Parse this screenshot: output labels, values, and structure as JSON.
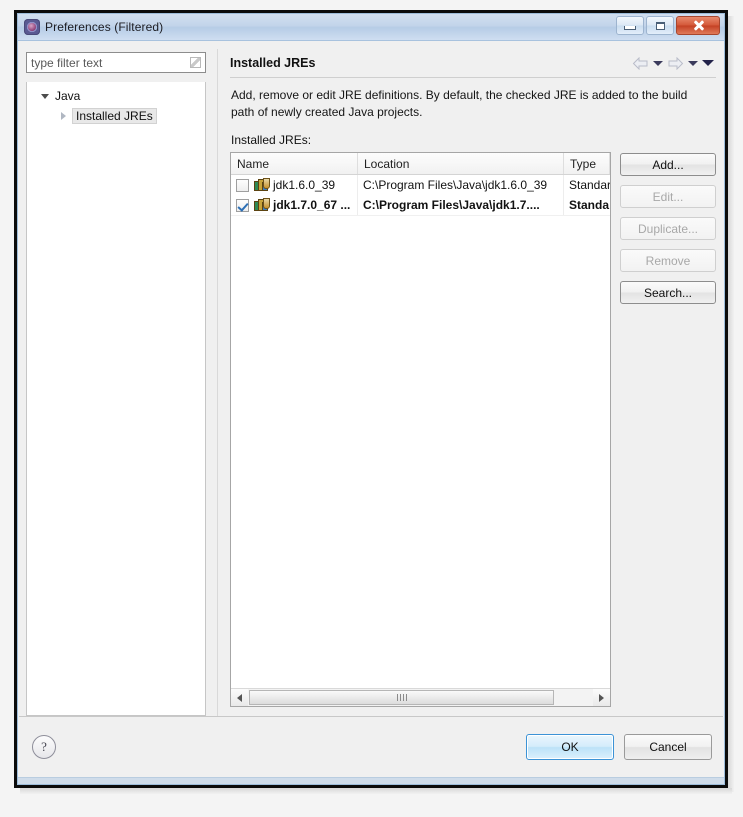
{
  "window": {
    "title": "Preferences (Filtered)",
    "icon": "preferences-gear-icon",
    "buttons": {
      "minimize": "minimize-icon",
      "maximize": "maximize-icon",
      "close": "close-icon"
    }
  },
  "sidebar": {
    "filter": {
      "placeholder": "type filter text",
      "value": ""
    },
    "tree": [
      {
        "label": "Java",
        "expanded": true,
        "level": 1,
        "selected": false
      },
      {
        "label": "Installed JREs",
        "expanded": false,
        "level": 2,
        "selected": true
      }
    ]
  },
  "pane": {
    "title": "Installed JREs",
    "description": "Add, remove or edit JRE definitions. By default, the checked JRE is added to the build path of newly created Java projects.",
    "nav": {
      "back": "back-arrow-icon",
      "back_menu": "back-dropdown-icon",
      "forward": "forward-arrow-icon",
      "forward_menu": "forward-dropdown-icon",
      "menu": "view-menu-icon"
    },
    "table_label": "Installed JREs:",
    "columns": [
      "Name",
      "Location",
      "Type"
    ],
    "rows": [
      {
        "checked": false,
        "bold": false,
        "name": "jdk1.6.0_39",
        "location": "C:\\Program Files\\Java\\jdk1.6.0_39",
        "type": "Standar"
      },
      {
        "checked": true,
        "bold": true,
        "name": "jdk1.7.0_67 ...",
        "location": "C:\\Program Files\\Java\\jdk1.7....",
        "type": "Standa"
      }
    ],
    "side_buttons": [
      {
        "label": "Add...",
        "enabled": true
      },
      {
        "label": "Edit...",
        "enabled": false
      },
      {
        "label": "Duplicate...",
        "enabled": false
      },
      {
        "label": "Remove",
        "enabled": false
      },
      {
        "label": "Search...",
        "enabled": true
      }
    ],
    "scrollbar": {
      "left_arrow": "scroll-left-icon",
      "right_arrow": "scroll-right-icon",
      "thumb": "scroll-thumb"
    }
  },
  "footer": {
    "help": "?",
    "ok": "OK",
    "cancel": "Cancel"
  },
  "colors": {
    "title_bar": "#c2d4ea",
    "close_button": "#c44124",
    "default_button_border": "#3c93d6",
    "checkbox_check": "#2c6fb5"
  }
}
